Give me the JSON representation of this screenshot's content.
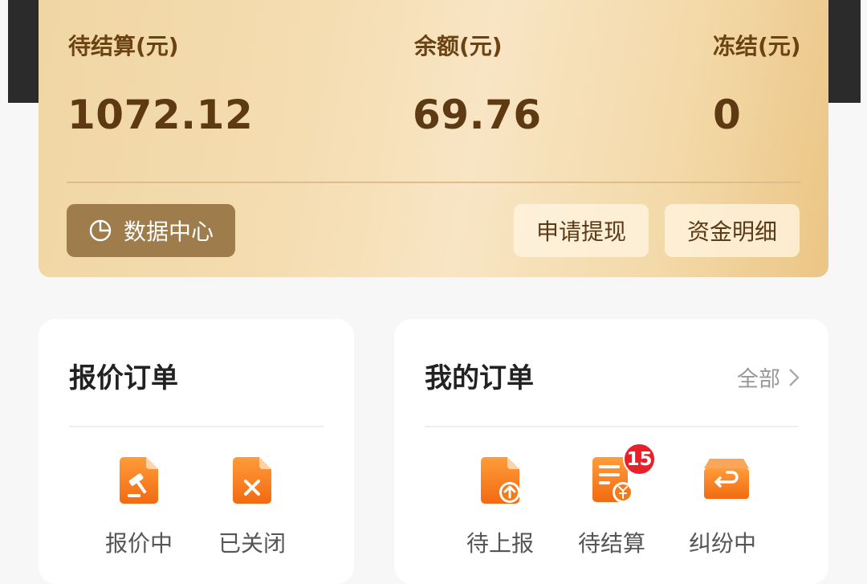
{
  "wallet": {
    "pending_label": "待结算(元)",
    "pending_value": "1072.12",
    "balance_label": "余额(元)",
    "balance_value": "69.76",
    "frozen_label": "冻结(元)",
    "frozen_value": "0",
    "data_center_label": "数据中心",
    "withdraw_label": "申请提现",
    "funds_detail_label": "资金明细"
  },
  "quote_orders": {
    "title": "报价订单",
    "items": [
      {
        "label": "报价中",
        "icon": "auction-hammer-document-icon"
      },
      {
        "label": "已关闭",
        "icon": "closed-document-icon"
      }
    ]
  },
  "my_orders": {
    "title": "我的订单",
    "all_label": "全部",
    "items": [
      {
        "label": "待上报",
        "icon": "upload-document-icon"
      },
      {
        "label": "待结算",
        "icon": "yuan-bill-icon",
        "badge": "15"
      },
      {
        "label": "纠纷中",
        "icon": "return-box-icon"
      }
    ]
  },
  "colors": {
    "accent_orange": "#f57d1c",
    "card_gold": "#f3d9a8",
    "badge_red": "#e8202a"
  }
}
